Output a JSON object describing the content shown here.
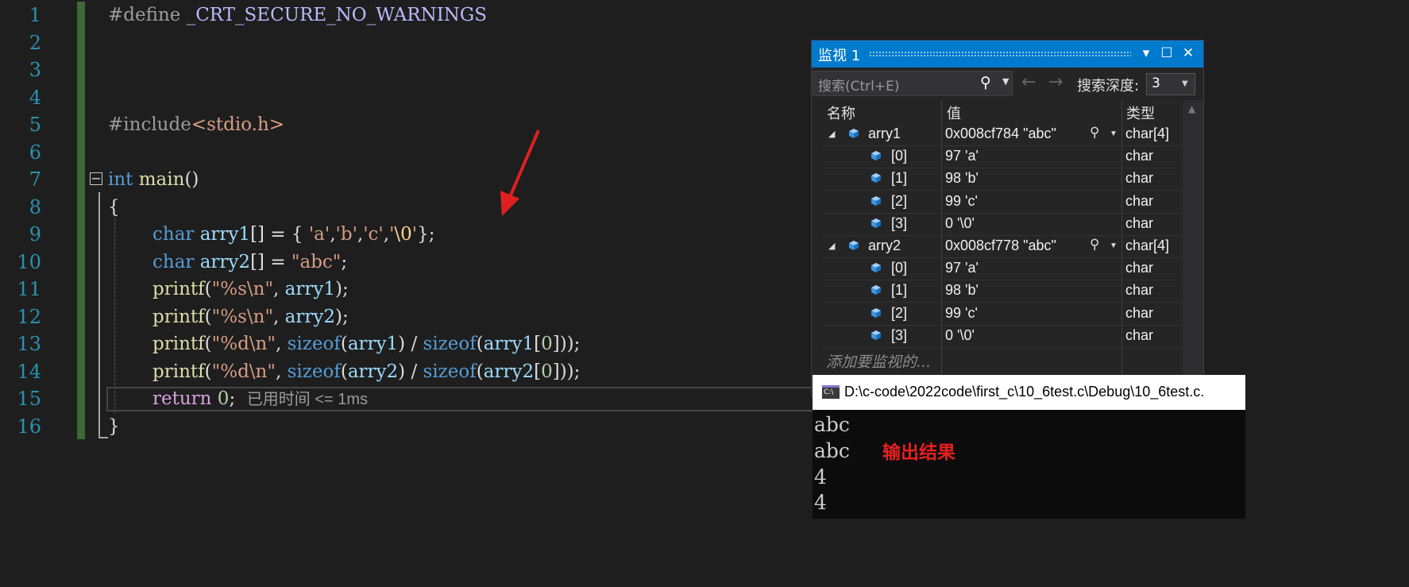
{
  "editor": {
    "line_numbers": [
      "1",
      "2",
      "3",
      "4",
      "5",
      "6",
      "7",
      "8",
      "9",
      "10",
      "11",
      "12",
      "13",
      "14",
      "15",
      "16"
    ],
    "l1": {
      "kw": "#define",
      "macro": "_CRT_SECURE_NO_WARNINGS"
    },
    "l5": {
      "kw": "#include",
      "hdr": "<stdio.h>"
    },
    "l7": {
      "type": "int",
      "fn": "main",
      "rest": "()"
    },
    "l8": "{",
    "l9": {
      "type": "char",
      "var": "arry1",
      "p1": "[] = { ",
      "c1": "'a'",
      "sep1": ",",
      "c2": "'b'",
      "sep2": ",",
      "c3": "'c'",
      "sep3": ",",
      "c4a": "'",
      "c4esc": "\\0",
      "c4b": "'",
      "p2": "};"
    },
    "l10": {
      "type": "char",
      "var": "arry2",
      "p1": "[] = ",
      "str": "\"abc\"",
      "p2": ";"
    },
    "l11": {
      "fn": "printf",
      "p1": "(",
      "str": "\"%s\\n\"",
      "p2": ", ",
      "var": "arry1",
      "p3": ");"
    },
    "l12": {
      "fn": "printf",
      "p1": "(",
      "str": "\"%s\\n\"",
      "p2": ", ",
      "var": "arry2",
      "p3": ");"
    },
    "l13": {
      "fn": "printf",
      "p1": "(",
      "str": "\"%d\\n\"",
      "p2": ", ",
      "kw1": "sizeof",
      "p3": "(",
      "var1": "arry1",
      "p4": ") / ",
      "kw2": "sizeof",
      "p5": "(",
      "var2": "arry1",
      "p6": "[",
      "num": "0",
      "p7": "]));"
    },
    "l14": {
      "fn": "printf",
      "p1": "(",
      "str": "\"%d\\n\"",
      "p2": ", ",
      "kw1": "sizeof",
      "p3": "(",
      "var1": "arry2",
      "p4": ") / ",
      "kw2": "sizeof",
      "p5": "(",
      "var2": "arry2",
      "p6": "[",
      "num": "0",
      "p7": "]));"
    },
    "l15": {
      "kw": "return",
      "num": "0",
      "p1": ";",
      "elapsed": "已用时间 <= 1ms"
    },
    "l16": "}"
  },
  "watch": {
    "title": "监视 1",
    "search_placeholder": "搜索(Ctrl+E)",
    "back_arrow": "←",
    "forward_arrow": "→",
    "depth_label": "搜索深度:",
    "depth_value": "3",
    "columns": {
      "name": "名称",
      "value": "值",
      "type": "类型"
    },
    "rows": [
      {
        "name": "arry1",
        "value": "0x008cf784 \"abc\"",
        "type": "char[4]",
        "parent": true
      },
      {
        "name": "[0]",
        "value": "97 'a'",
        "type": "char"
      },
      {
        "name": "[1]",
        "value": "98 'b'",
        "type": "char"
      },
      {
        "name": "[2]",
        "value": "99 'c'",
        "type": "char"
      },
      {
        "name": "[3]",
        "value": "0 '\\0'",
        "type": "char"
      },
      {
        "name": "arry2",
        "value": "0x008cf778 \"abc\"",
        "type": "char[4]",
        "parent": true
      },
      {
        "name": "[0]",
        "value": "97 'a'",
        "type": "char"
      },
      {
        "name": "[1]",
        "value": "98 'b'",
        "type": "char"
      },
      {
        "name": "[2]",
        "value": "99 'c'",
        "type": "char"
      },
      {
        "name": "[3]",
        "value": "0 '\\0'",
        "type": "char"
      }
    ],
    "add_placeholder": "添加要监视的..."
  },
  "console": {
    "title": "D:\\c-code\\2022code\\first_c\\10_6test.c\\Debug\\10_6test.c.",
    "icon_text": "C:\\",
    "lines": [
      "abc",
      "abc",
      "4",
      "4"
    ],
    "annotation": "输出结果"
  },
  "colors": {
    "accent": "#007acc",
    "annotation": "#e81f1f",
    "arrow": "#e02020"
  }
}
